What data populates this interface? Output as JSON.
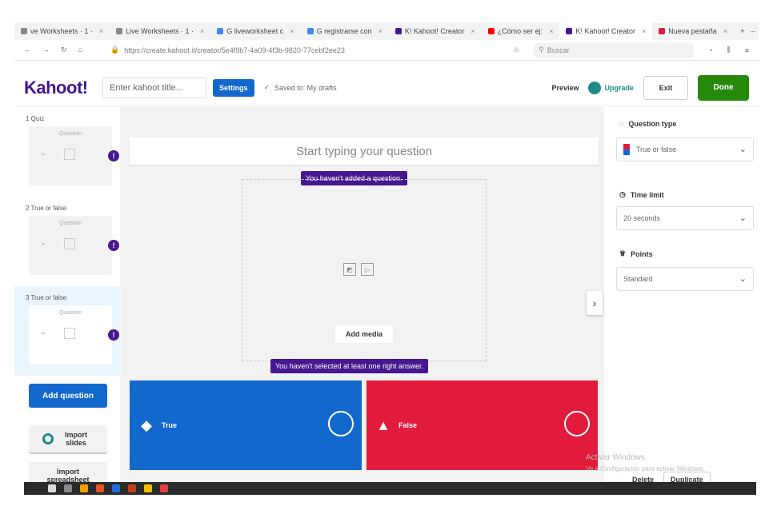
{
  "browser": {
    "tabs": [
      {
        "label": "ve Worksheets · 1 ·",
        "color": "#888888"
      },
      {
        "label": "Live Worksheets · 1 ·",
        "color": "#888888"
      },
      {
        "label": "G liveworksheet c",
        "color": "#4285f4"
      },
      {
        "label": "G registrarse con",
        "color": "#4285f4"
      },
      {
        "label": "K! Kahoot! Creator",
        "color": "#46178f"
      },
      {
        "label": "¿Cómo ser ej:",
        "color": "#ff0000"
      },
      {
        "label": "K! Kahoot! Creator",
        "color": "#46178f",
        "active": true
      },
      {
        "label": "Nueva pestaña",
        "color": "#e21b3c"
      }
    ],
    "new_tab": "+",
    "url": "https://create.kahoot.it/creator/5e4f9b7-4a09-4f3b-9820-77cebf2ee23",
    "search_placeholder": "Buscar"
  },
  "header": {
    "logo": "Kahoot!",
    "title_placeholder": "Enter kahoot title...",
    "settings": "Settings",
    "saved": "Saved to: My drafts",
    "preview": "Preview",
    "upgrade": "Upgrade",
    "exit": "Exit",
    "done": "Done"
  },
  "sidebar": {
    "slides": [
      {
        "label": "1 Quiz",
        "card": "Question",
        "selected": false
      },
      {
        "label": "2 True or false",
        "card": "Question",
        "selected": false
      },
      {
        "label": "3 True or false",
        "card": "Question",
        "selected": true
      }
    ],
    "warning": "!",
    "add_question": "Add question",
    "import_slides": "Import slides",
    "import_spreadsheet": "Import spreadsheet"
  },
  "editor": {
    "question_placeholder": "Start typing your question",
    "tip_question": "You haven't added a question.",
    "add_media": "Add media",
    "tip_answer": "You haven't selected at least one right answer.",
    "answers": [
      {
        "text": "True",
        "shape": "◆",
        "color": "#1368ce"
      },
      {
        "text": "False",
        "shape": "▲",
        "color": "#e21b3c"
      }
    ]
  },
  "panel": {
    "question_type_label": "Question type",
    "question_type_value": "True or false",
    "time_limit_label": "Time limit",
    "time_limit_value": "20 seconds",
    "points_label": "Points",
    "points_value": "Standard",
    "delete": "Delete",
    "duplicate": "Duplicate",
    "watermark_line1": "Activar Windows",
    "watermark_line2": "Ve a Configuración para activar Windows."
  }
}
